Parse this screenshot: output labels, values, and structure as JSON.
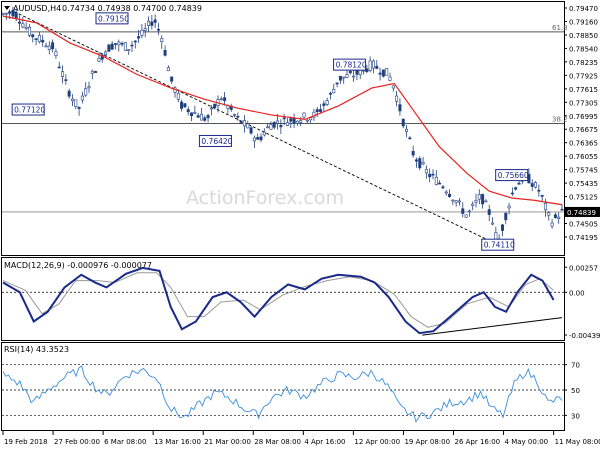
{
  "header": {
    "symbol": "AUDUSD,H4",
    "quote": "0.74734 0.74938 0.74700 0.74839"
  },
  "watermark": "ActionForex.com",
  "colors": {
    "candle": "#1f3f7f",
    "ma": "#e8231f",
    "macd": "#1a2a8a",
    "signal": "#9a9a9a",
    "rsi": "#3d8fd8",
    "annotation_box": "#1a2a8a",
    "grid_dotted": "#000000",
    "watermark": "#d9d9d9"
  },
  "chart_data": [
    {
      "type": "candlestick",
      "title": "AUDUSD,H4",
      "y_ticks": [
        "0.79470",
        "0.79160",
        "0.78850",
        "0.78540",
        "0.78235",
        "0.77925",
        "0.77615",
        "0.77305",
        "0.76995",
        "0.76675",
        "0.76365",
        "0.76055",
        "0.75745",
        "0.75435",
        "0.75125",
        "0.74815",
        "0.74505",
        "0.74195"
      ],
      "ylim": [
        0.73925,
        0.7947
      ],
      "x_tick_labels": [
        "19 Feb 2018",
        "27 Feb 00:00",
        "6 Mar 08:00",
        "13 Mar 16:00",
        "21 Mar 00:00",
        "28 Mar 08:00",
        "4 Apr 16:00",
        "12 Apr 00:00",
        "19 Apr 08:00",
        "26 Apr 16:00",
        "4 May 00:00",
        "11 May 08:00"
      ],
      "price_tag": "0.74839",
      "price_tag_value": 0.74839,
      "levels": [
        {
          "label": "61.8",
          "value": 0.7885
        },
        {
          "label": "38.2",
          "value": 0.7681
        }
      ],
      "annotations": [
        {
          "label": "0.79150",
          "x": 0.195,
          "value": 0.7915
        },
        {
          "label": "0.77120",
          "x": 0.045,
          "value": 0.7712
        },
        {
          "label": "0.76420",
          "x": 0.38,
          "value": 0.7642
        },
        {
          "label": "0.78120",
          "x": 0.62,
          "value": 0.7812
        },
        {
          "label": "0.75660",
          "x": 0.91,
          "value": 0.7566
        },
        {
          "label": "0.74110",
          "x": 0.885,
          "value": 0.7411
        }
      ],
      "trendline": [
        [
          0.02,
          0.793
        ],
        [
          0.885,
          0.7411
        ]
      ],
      "price_path": [
        [
          0.0,
          0.7925
        ],
        [
          0.02,
          0.793
        ],
        [
          0.05,
          0.788
        ],
        [
          0.09,
          0.785
        ],
        [
          0.115,
          0.776
        ],
        [
          0.135,
          0.7712
        ],
        [
          0.16,
          0.779
        ],
        [
          0.18,
          0.784
        ],
        [
          0.2,
          0.786
        ],
        [
          0.225,
          0.785
        ],
        [
          0.25,
          0.788
        ],
        [
          0.27,
          0.7915
        ],
        [
          0.285,
          0.787
        ],
        [
          0.3,
          0.778
        ],
        [
          0.32,
          0.772
        ],
        [
          0.35,
          0.77
        ],
        [
          0.365,
          0.769
        ],
        [
          0.39,
          0.774
        ],
        [
          0.42,
          0.769
        ],
        [
          0.44,
          0.767
        ],
        [
          0.455,
          0.7642
        ],
        [
          0.48,
          0.768
        ],
        [
          0.52,
          0.769
        ],
        [
          0.56,
          0.77
        ],
        [
          0.585,
          0.774
        ],
        [
          0.6,
          0.778
        ],
        [
          0.63,
          0.779
        ],
        [
          0.66,
          0.7812
        ],
        [
          0.69,
          0.779
        ],
        [
          0.7,
          0.776
        ],
        [
          0.715,
          0.769
        ],
        [
          0.735,
          0.761
        ],
        [
          0.76,
          0.757
        ],
        [
          0.79,
          0.754
        ],
        [
          0.81,
          0.751
        ],
        [
          0.83,
          0.7475
        ],
        [
          0.855,
          0.752
        ],
        [
          0.875,
          0.747
        ],
        [
          0.885,
          0.7411
        ],
        [
          0.9,
          0.748
        ],
        [
          0.915,
          0.754
        ],
        [
          0.935,
          0.7566
        ],
        [
          0.96,
          0.753
        ],
        [
          0.98,
          0.746
        ],
        [
          1.0,
          0.7484
        ]
      ],
      "ma_path": [
        [
          0.0,
          0.792
        ],
        [
          0.06,
          0.7905
        ],
        [
          0.12,
          0.786
        ],
        [
          0.18,
          0.783
        ],
        [
          0.24,
          0.779
        ],
        [
          0.3,
          0.776
        ],
        [
          0.36,
          0.7735
        ],
        [
          0.42,
          0.7715
        ],
        [
          0.48,
          0.77
        ],
        [
          0.54,
          0.769
        ],
        [
          0.6,
          0.772
        ],
        [
          0.66,
          0.776
        ],
        [
          0.7,
          0.777
        ],
        [
          0.74,
          0.77
        ],
        [
          0.78,
          0.763
        ],
        [
          0.83,
          0.757
        ],
        [
          0.87,
          0.753
        ],
        [
          0.91,
          0.7515
        ],
        [
          0.95,
          0.751
        ],
        [
          1.0,
          0.75
        ]
      ]
    },
    {
      "type": "line",
      "title": "MACD(12,26,9) -0.000976 -0.000077",
      "y_ticks": [
        "0.00257",
        "0.00",
        "-0.004392"
      ],
      "ylim": [
        -0.0047,
        0.0027
      ],
      "series": [
        {
          "name": "MACD",
          "values": [
            [
              0.0,
              0.001
            ],
            [
              0.03,
              0.0
            ],
            [
              0.055,
              -0.003
            ],
            [
              0.08,
              -0.002
            ],
            [
              0.11,
              0.0005
            ],
            [
              0.14,
              0.0018
            ],
            [
              0.165,
              0.001
            ],
            [
              0.185,
              0.0005
            ],
            [
              0.22,
              0.0019
            ],
            [
              0.25,
              0.0025
            ],
            [
              0.28,
              0.0022
            ],
            [
              0.3,
              -0.0015
            ],
            [
              0.32,
              -0.0038
            ],
            [
              0.345,
              -0.003
            ],
            [
              0.375,
              -0.0005
            ],
            [
              0.4,
              0.0
            ],
            [
              0.425,
              -0.001
            ],
            [
              0.45,
              -0.0025
            ],
            [
              0.48,
              -0.0005
            ],
            [
              0.51,
              0.0008
            ],
            [
              0.54,
              0.0003
            ],
            [
              0.57,
              0.0014
            ],
            [
              0.6,
              0.0018
            ],
            [
              0.64,
              0.0016
            ],
            [
              0.665,
              0.001
            ],
            [
              0.69,
              -0.0005
            ],
            [
              0.72,
              -0.003
            ],
            [
              0.745,
              -0.0042
            ],
            [
              0.77,
              -0.004
            ],
            [
              0.79,
              -0.003
            ],
            [
              0.81,
              -0.002
            ],
            [
              0.84,
              -0.0005
            ],
            [
              0.86,
              0.0
            ],
            [
              0.88,
              -0.0015
            ],
            [
              0.9,
              -0.002
            ],
            [
              0.92,
              0.0
            ],
            [
              0.945,
              0.0018
            ],
            [
              0.965,
              0.0012
            ],
            [
              0.985,
              -0.0008
            ]
          ]
        },
        {
          "name": "Signal",
          "values": [
            [
              0.0,
              0.0012
            ],
            [
              0.04,
              0.0002
            ],
            [
              0.07,
              -0.0022
            ],
            [
              0.1,
              -0.0012
            ],
            [
              0.13,
              0.0012
            ],
            [
              0.17,
              0.0012
            ],
            [
              0.2,
              0.001
            ],
            [
              0.24,
              0.002
            ],
            [
              0.275,
              0.002
            ],
            [
              0.3,
              0.0005
            ],
            [
              0.33,
              -0.0025
            ],
            [
              0.36,
              -0.0025
            ],
            [
              0.39,
              -0.001
            ],
            [
              0.43,
              -0.0008
            ],
            [
              0.46,
              -0.0018
            ],
            [
              0.5,
              -0.0003
            ],
            [
              0.54,
              0.0006
            ],
            [
              0.58,
              0.0012
            ],
            [
              0.62,
              0.0016
            ],
            [
              0.66,
              0.0012
            ],
            [
              0.7,
              -0.0002
            ],
            [
              0.73,
              -0.0025
            ],
            [
              0.76,
              -0.0036
            ],
            [
              0.79,
              -0.0032
            ],
            [
              0.83,
              -0.0012
            ],
            [
              0.87,
              -0.0005
            ],
            [
              0.905,
              -0.0015
            ],
            [
              0.935,
              0.0008
            ],
            [
              0.96,
              0.0014
            ],
            [
              0.985,
              0.0002
            ]
          ]
        }
      ],
      "trendline": [
        [
          0.75,
          -0.0044
        ],
        [
          1.0,
          -0.0026
        ]
      ]
    },
    {
      "type": "line",
      "title": "RSI(14) 43.3523",
      "y_ticks": [
        "70",
        "50",
        "30"
      ],
      "ylim": [
        20,
        80
      ],
      "levels": [
        70,
        50,
        30
      ],
      "series": [
        {
          "name": "RSI",
          "values": [
            [
              0.0,
              62
            ],
            [
              0.03,
              55
            ],
            [
              0.055,
              40
            ],
            [
              0.08,
              50
            ],
            [
              0.11,
              60
            ],
            [
              0.14,
              66
            ],
            [
              0.165,
              52
            ],
            [
              0.185,
              46
            ],
            [
              0.22,
              62
            ],
            [
              0.25,
              66
            ],
            [
              0.275,
              60
            ],
            [
              0.3,
              35
            ],
            [
              0.325,
              28
            ],
            [
              0.35,
              38
            ],
            [
              0.38,
              48
            ],
            [
              0.405,
              44
            ],
            [
              0.43,
              36
            ],
            [
              0.455,
              30
            ],
            [
              0.48,
              44
            ],
            [
              0.51,
              50
            ],
            [
              0.54,
              45
            ],
            [
              0.57,
              55
            ],
            [
              0.6,
              62
            ],
            [
              0.63,
              60
            ],
            [
              0.66,
              64
            ],
            [
              0.69,
              52
            ],
            [
              0.71,
              36
            ],
            [
              0.74,
              28
            ],
            [
              0.77,
              32
            ],
            [
              0.8,
              40
            ],
            [
              0.83,
              42
            ],
            [
              0.855,
              48
            ],
            [
              0.875,
              35
            ],
            [
              0.895,
              30
            ],
            [
              0.915,
              55
            ],
            [
              0.935,
              65
            ],
            [
              0.955,
              58
            ],
            [
              0.975,
              40
            ],
            [
              1.0,
              43.35
            ]
          ]
        }
      ]
    }
  ]
}
